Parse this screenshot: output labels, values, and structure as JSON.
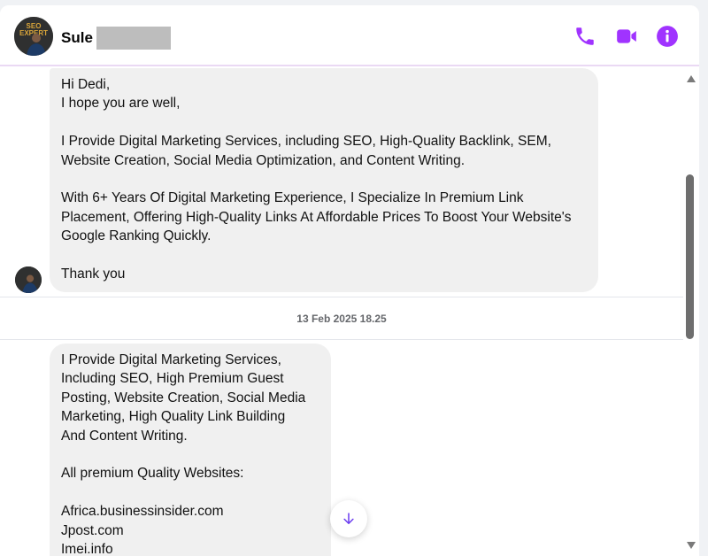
{
  "header": {
    "contact_name": "Sule",
    "actions": {
      "call": "phone-icon",
      "video": "video-camera-icon",
      "info": "info-icon"
    },
    "accent_color": "#a033ff"
  },
  "messages": [
    {
      "text": "Hi Dedi,\nI hope you are well,\n\nI Provide Digital Marketing Services, including SEO, High-Quality Backlink, SEM,\nWebsite Creation, Social Media Optimization, and Content Writing.\n\nWith 6+ Years Of Digital Marketing Experience, I Specialize In Premium Link\nPlacement, Offering High-Quality Links At Affordable Prices To Boost Your Website's\nGoogle Ranking Quickly.\n\nThank you"
    },
    {
      "text": "I Provide Digital Marketing Services,\nIncluding SEO, High Premium Guest\nPosting, Website Creation, Social Media\nMarketing, High Quality Link Building\nAnd Content Writing.\n\nAll premium Quality Websites:\n\nAfrica.businessinsider.com\nJpost.com\nImei.info"
    }
  ],
  "timestamp": "13 Feb 2025 18.25",
  "avatar_text": "SEO EXPERT"
}
